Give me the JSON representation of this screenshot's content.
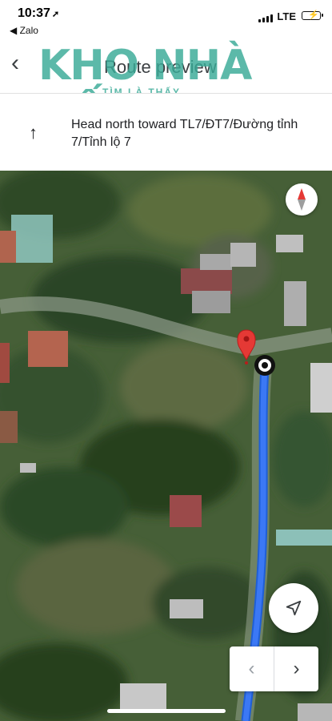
{
  "status_bar": {
    "time": "10:37",
    "location_arrow": "➚",
    "back_app_label": "◀ Zalo",
    "network": "LTE",
    "battery_icon": "battery-charging-icon"
  },
  "header": {
    "title": "Route preview",
    "back_icon": "chevron-left-icon",
    "watermark_main": "KHO NHÀ ĐẤT",
    "watermark_sub": "TÌM LÀ THẤY"
  },
  "step": {
    "icon": "arrow-up-icon",
    "instruction": "Head north toward TL7/ĐT7/Đường tỉnh 7/Tỉnh lộ 7"
  },
  "map": {
    "compass_icon": "compass-icon",
    "locate_icon": "navigation-arrow-icon",
    "prev_label": "‹",
    "next_label": "›",
    "route_color": "#3b78f5",
    "pin_color": "#e53935"
  }
}
